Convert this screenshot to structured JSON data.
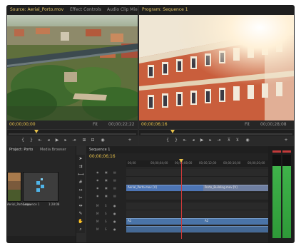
{
  "source_monitor": {
    "tabs": [
      "Source: Aerial_Porto.mov",
      "Effect Controls",
      "Audio Clip Mixer"
    ],
    "timecode_left": "00;00;00;00",
    "timecode_right": "00;00;22;22",
    "zoom": "Fit",
    "playhead_fraction": 0.22
  },
  "program_monitor": {
    "tabs": [
      "Program: Sequence 1"
    ],
    "timecode_left": "00;00;06;16",
    "timecode_right": "00;00;28;08",
    "zoom": "Fit",
    "playhead_fraction": 0.21
  },
  "project_panel": {
    "tabs": [
      "Project: Porto",
      "Media Browser"
    ],
    "items": [
      {
        "label": "Aerial_Porto.mov"
      },
      {
        "label": "Sequence 1",
        "duration": "1:28:08"
      }
    ]
  },
  "timeline": {
    "tab": "Sequence 1",
    "timecode": "00;00;06;16",
    "ruler_ticks": [
      "00;00",
      "00;00;04;00",
      "00;00;08;00",
      "00;00;12;00",
      "00;00;16;00",
      "00;00;20;00"
    ],
    "video_clips": [
      {
        "label": "Aerial_Porto.mov [V]"
      },
      {
        "label": "Porto_Building.mov [V]"
      }
    ],
    "audio_clips": [
      {
        "label": "A1"
      },
      {
        "label": "A2"
      }
    ]
  },
  "audio_meter": {
    "level_left": 0.86,
    "level_right": 0.86,
    "peak_color": "#c23a3a"
  },
  "colors": {
    "accent": "#e8c24a",
    "playhead": "#d03a3a",
    "clip_video": "#4d75b5"
  }
}
